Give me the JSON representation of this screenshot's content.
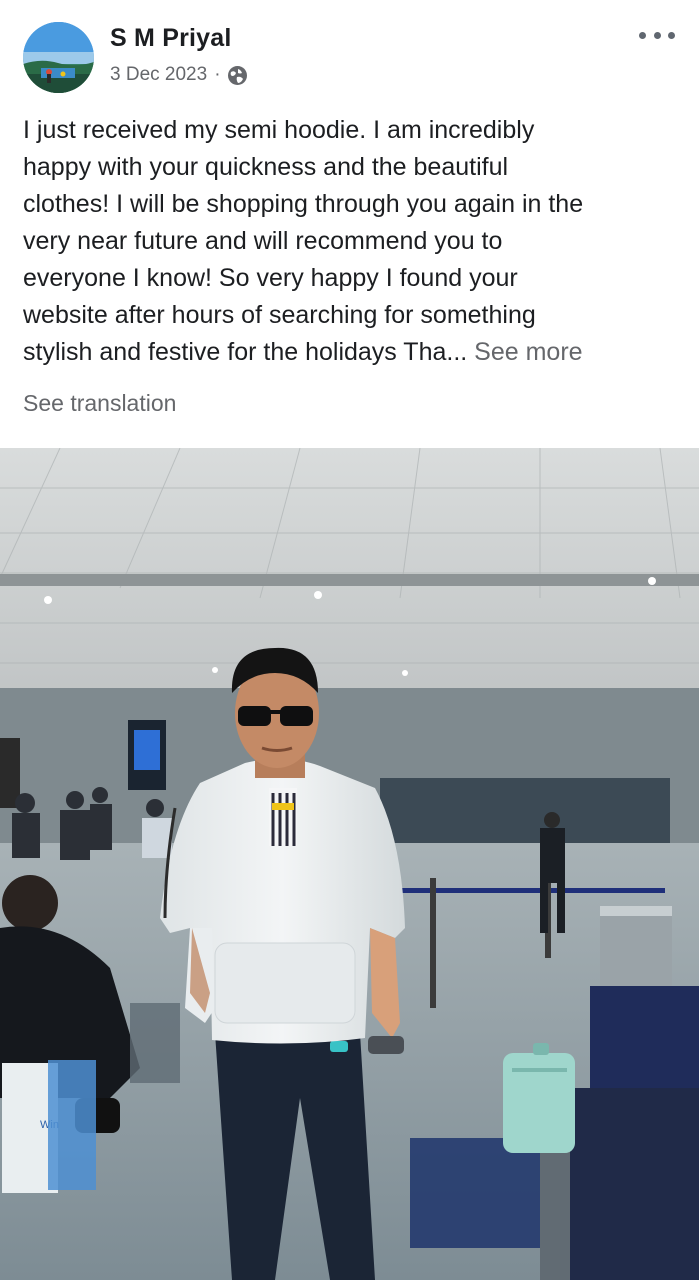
{
  "post": {
    "author": "S M Priyal",
    "date": "3 Dec 2023",
    "separator": "·",
    "privacy_icon": "globe-icon",
    "more_icon": "more-horizontal-icon",
    "text_lines": [
      "I just received my semi hoodie. I am incredibly",
      "happy with your quickness and the beautiful",
      "clothes! I will be shopping through you again in the",
      "very near future and will recommend you to",
      "everyone I know! So very happy I found your",
      "website after hours of searching for something",
      "stylish and festive for the holidays Tha..."
    ],
    "see_more": "See more",
    "see_translation": "See translation"
  },
  "photo": {
    "bag_label": "Win"
  },
  "colors": {
    "name_text": "#1c1e21",
    "secondary_text": "#65676b",
    "hoodie": "#eef1f2",
    "floor": "#8b9aa2"
  }
}
